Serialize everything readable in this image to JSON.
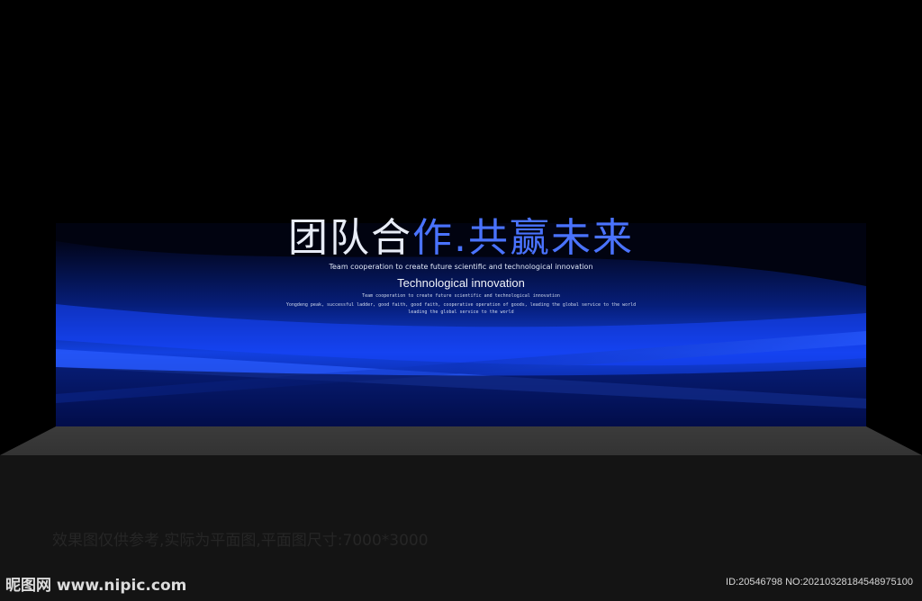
{
  "backdrop": {
    "title_main": "团队合作",
    "title_accent": "作.共赢未来",
    "title_prefix": "团队合",
    "subtitle": "Team cooperation to create future scientific and technological innovation",
    "heading": "Technological innovation",
    "lines": [
      "Team cooperation to create future scientific and technological innovation",
      "Yongdeng peak, successful ladder, good faith, good faith, cooperative operation of goods, leading the global service to the world",
      "leading the global service to the world"
    ],
    "colors": {
      "background": "#000000",
      "blue_dark": "#051a6e",
      "blue_bright": "#1a4dff",
      "accent_text": "#4a73ff"
    }
  },
  "disclaimer": "效果图仅供参考,实际为平面图,平面图尺寸:7000*3000",
  "watermark": "昵图网 www.nipic.com",
  "image_id": "ID:20546798 NO:20210328184548975100"
}
